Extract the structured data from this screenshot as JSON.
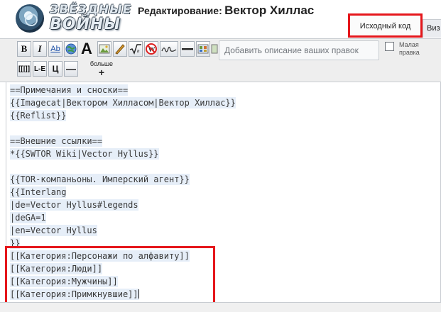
{
  "header": {
    "logo_line1": "ЗВЁЗДНЫЕ",
    "logo_line2": "ВОЙНЫ",
    "title_prefix": "Редактирование:",
    "title_name": "Вектор Хиллас"
  },
  "tabs": {
    "source": "Исходный код",
    "visual": "Виз"
  },
  "toolbar": {
    "bold": "B",
    "italic": "I",
    "link": "Ab",
    "big": "A",
    "sig": "[[|]]",
    "le": "L-E",
    "ts": "Ц",
    "hr": "—",
    "more": "больше",
    "more_plus": "+"
  },
  "summary": {
    "placeholder": "Добавить описание ваших правок"
  },
  "minor_edit": {
    "label": "Малая правка"
  },
  "editor_lines": [
    "==Примечания и сноски==",
    "{{Imagecat|Вектором Хилласом|Вектор Хиллас}}",
    "{{Reflist}}",
    "",
    "==Внешние ссылки==",
    "*{{SWTOR Wiki|Vector Hyllus}}",
    "",
    "{{TOR-компаньоны. Имперский агент}}",
    "{{Interlang",
    "|de=Vector Hyllus#legends",
    "|deGA=1",
    "|en=Vector Hyllus",
    "}}",
    "[[Категория:Персонажи по алфавиту]]",
    "[[Категория:Люди]]",
    "[[Категория:Мужчины]]",
    "[[Категория:Примкнувшие]]"
  ]
}
